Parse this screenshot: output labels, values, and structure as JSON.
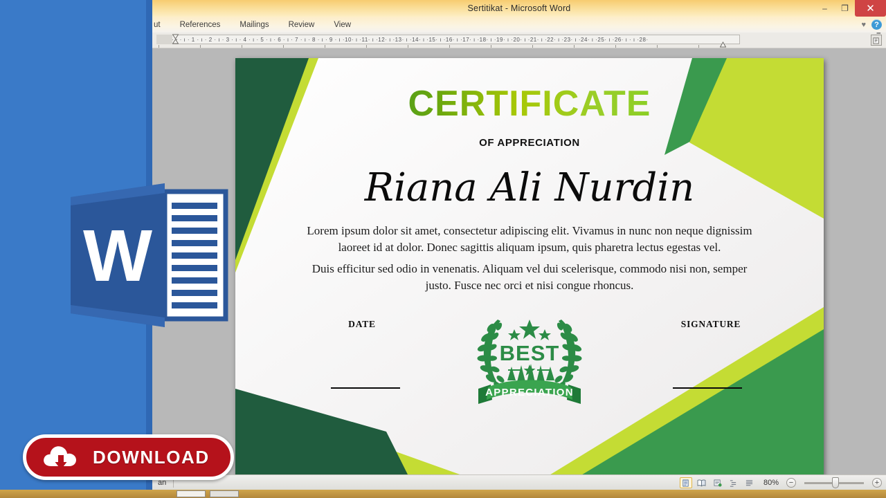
{
  "window": {
    "title": "Sertitikat  -  Microsoft Word",
    "controls": {
      "minimize": "–",
      "restore": "❐",
      "close": "✕"
    },
    "collapse_ribbon_icon": "collapse-ribbon-icon",
    "help_icon_label": "?"
  },
  "ribbon": {
    "tabs": [
      {
        "label": "ut",
        "name": "tab-layout-clipped"
      },
      {
        "label": "References",
        "name": "tab-references"
      },
      {
        "label": "Mailings",
        "name": "tab-mailings"
      },
      {
        "label": "Review",
        "name": "tab-review"
      },
      {
        "label": "View",
        "name": "tab-view"
      }
    ]
  },
  "ruler": {
    "marks": "1 · ı · ꞏ · ı · 1 · ı · 2 · ı · 3 · ı · 4 · ı · 5 · ı · 6 · ı · 7 · ı · 8 · ı · 9 · ı ·10· ı ·11· ı ·12· ı ·13· ı ·14· ı ·15· ı ·16· ı ·17· ı ·18· ı ·19· ı ·20· ı ·21· ı ·22· ı ·23· ı ·24· ı ·25· ı ·26· ı ·      ı ·28·"
  },
  "certificate": {
    "title": "CERTIFICATE",
    "subtitle": "OF APPRECIATION",
    "recipient_name": "Riana Ali Nurdin",
    "paragraph_1": "Lorem ipsum dolor sit amet, consectetur adipiscing elit. Vivamus in nunc non neque dignissim laoreet id at dolor. Donec sagittis aliquam ipsum, quis pharetra lectus egestas vel.",
    "paragraph_2": "Duis efficitur sed odio in venenatis. Aliquam vel dui scelerisque, commodo nisi non, semper justo. Fusce nec orci et nisi congue rhoncus.",
    "date_label": "DATE",
    "signature_label": "SIGNATURE",
    "seal": {
      "top_text": "BEST",
      "ribbon_text": "APPRECIATION"
    },
    "colors": {
      "dark_green": "#205c3e",
      "mid_green": "#3a9a4e",
      "lime": "#c4dc34",
      "page_background": "#f6f6f4",
      "title_gradient_start": "#188041",
      "title_gradient_end": "#4bd12a"
    }
  },
  "status_bar": {
    "left_text": "an",
    "zoom_level": "80%",
    "zoom_out_label": "−",
    "zoom_in_label": "+",
    "view_buttons": [
      {
        "name": "view-btn-print-layout",
        "label": "print-layout-icon"
      },
      {
        "name": "view-btn-full-screen-reading",
        "label": "full-screen-reading-icon"
      },
      {
        "name": "view-btn-web-layout",
        "label": "web-layout-icon"
      },
      {
        "name": "view-btn-outline",
        "label": "outline-icon"
      },
      {
        "name": "view-btn-draft",
        "label": "draft-icon"
      }
    ]
  },
  "promo": {
    "app_icon_letter": "W",
    "download_label": "DOWNLOAD",
    "download_icon": "cloud-download-icon",
    "button_color": "#b5121b",
    "panel_color": "#3a7ac8"
  }
}
